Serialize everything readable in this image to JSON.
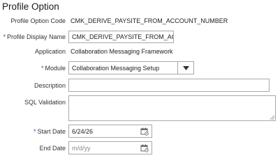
{
  "page": {
    "title": "Profile Option"
  },
  "fields": {
    "profile_option_code": {
      "label": "Profile Option Code",
      "value": "CMK_DERIVE_PAYSITE_FROM_ACCOUNT_NUMBER"
    },
    "profile_display_name": {
      "label": "Profile Display Name",
      "required": "*",
      "value": "CMK_DERIVE_PAYSITE_FROM_ACC"
    },
    "application": {
      "label": "Application",
      "value": "Collaboration Messaging Framework"
    },
    "module": {
      "label": "Module",
      "required": "*",
      "value": "Collaboration Messaging Setup"
    },
    "description": {
      "label": "Description",
      "value": ""
    },
    "sql_validation": {
      "label": "SQL Validation",
      "value": ""
    },
    "start_date": {
      "label": "Start Date",
      "required": "*",
      "value": "6/24/26"
    },
    "end_date": {
      "label": "End Date",
      "value": "",
      "placeholder": "m/d/yy"
    }
  },
  "icons": {
    "dropdown": "chevron-down-icon",
    "calendar": "calendar-icon"
  },
  "colors": {
    "required_asterisk": "#1a5fa3",
    "border": "#a9a9a9"
  }
}
